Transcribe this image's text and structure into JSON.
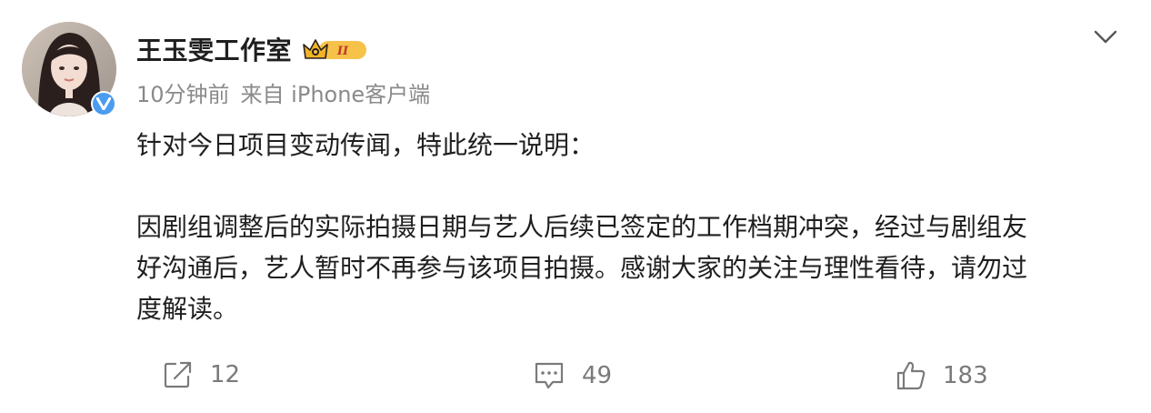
{
  "post": {
    "author": {
      "name": "王玉雯工作室",
      "vip_level": "II"
    },
    "meta": {
      "time": "10分钟前",
      "source": "来自 iPhone客户端"
    },
    "content": {
      "lines": [
        "针对今日项目变动传闻，特此统一说明：",
        "",
        "因剧组调整后的实际拍摄日期与艺人后续已签定的工作档期冲突，经过与剧组友",
        "好沟通后，艺人暂时不再参与该项目拍摄。感谢大家的关注与理性看待，请勿过",
        "度解读。"
      ]
    },
    "actions": {
      "repost_count": "12",
      "comment_count": "49",
      "like_count": "183"
    },
    "icons": {
      "repost": "repost-icon",
      "comment": "comment-icon",
      "like": "like-icon",
      "more": "chevron-down-icon",
      "verified": "verified-icon",
      "vip": "crown-icon"
    },
    "colors": {
      "text": "#1f1f1f",
      "meta": "#8a8a8a",
      "verified": "#4a9cf0",
      "vip_gold": "#f0b428"
    }
  }
}
